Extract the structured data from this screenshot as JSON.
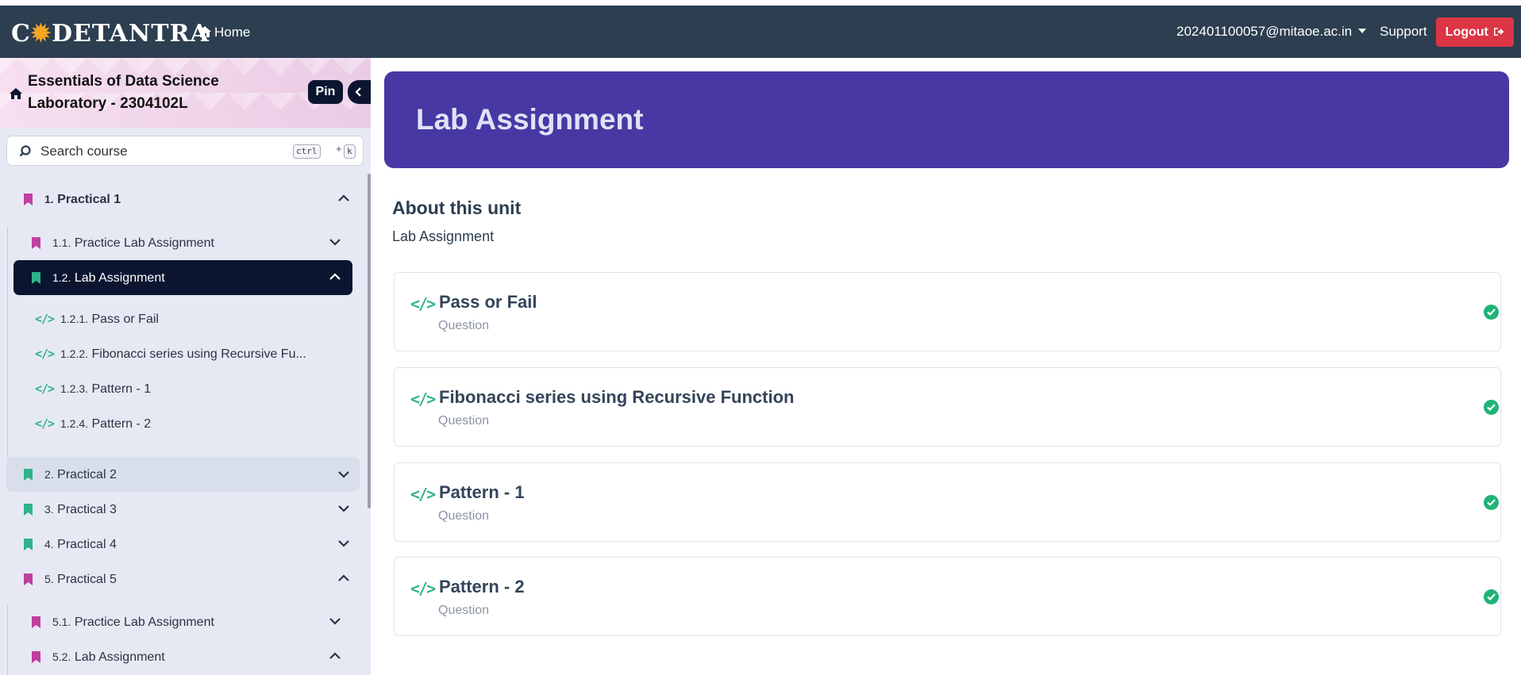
{
  "navbar": {
    "logo": "CODETANTRA",
    "home_label": "Home",
    "user_email": "202401100057@mitaoe.ac.in",
    "support_label": "Support",
    "logout_label": "Logout"
  },
  "sidebar": {
    "course_title": "Essentials of Data Science Laboratory - 2304102L",
    "pin_label": "Pin",
    "search_placeholder": "Search course",
    "shortcut": [
      "ctrl",
      "+",
      "k"
    ],
    "items": [
      {
        "num": "1.",
        "label": "Practical 1",
        "icon": "bookmark-icon",
        "color": "#c03fa0",
        "expanded": true
      },
      {
        "num": "1.1.",
        "label": "Practice Lab Assignment",
        "icon": "bookmark-icon",
        "color": "#c03fa0",
        "expanded": false
      },
      {
        "num": "1.2.",
        "label": "Lab Assignment",
        "icon": "bookmark-icon",
        "color": "#2fb38a",
        "expanded": true,
        "active": true
      },
      {
        "num": "1.2.1.",
        "label": "Pass or Fail",
        "icon": "code-icon"
      },
      {
        "num": "1.2.2.",
        "label": "Fibonacci series using Recursive Fu...",
        "icon": "code-icon"
      },
      {
        "num": "1.2.3.",
        "label": "Pattern - 1",
        "icon": "code-icon"
      },
      {
        "num": "1.2.4.",
        "label": "Pattern - 2",
        "icon": "code-icon"
      },
      {
        "num": "2.",
        "label": "Practical 2",
        "icon": "bookmark-icon",
        "color": "#2fb38a",
        "expanded": false
      },
      {
        "num": "3.",
        "label": "Practical 3",
        "icon": "bookmark-icon",
        "color": "#2fb38a",
        "expanded": false
      },
      {
        "num": "4.",
        "label": "Practical 4",
        "icon": "bookmark-icon",
        "color": "#2fb38a",
        "expanded": false
      },
      {
        "num": "5.",
        "label": "Practical 5",
        "icon": "bookmark-icon",
        "color": "#c03fa0",
        "expanded": true
      },
      {
        "num": "5.1.",
        "label": "Practice Lab Assignment",
        "icon": "bookmark-icon",
        "color": "#c03fa0",
        "expanded": false
      },
      {
        "num": "5.2.",
        "label": "Lab Assignment",
        "icon": "bookmark-icon",
        "color": "#c03fa0",
        "expanded": true
      }
    ]
  },
  "main": {
    "banner_title": "Lab Assignment",
    "about_title": "About this unit",
    "about_subtitle": "Lab Assignment",
    "cards": [
      {
        "title": "Pass or Fail",
        "type": "Question",
        "status": "completed"
      },
      {
        "title": "Fibonacci series using Recursive Function",
        "type": "Question",
        "status": "completed"
      },
      {
        "title": "Pattern - 1",
        "type": "Question",
        "status": "completed"
      },
      {
        "title": "Pattern - 2",
        "type": "Question",
        "status": "completed"
      }
    ]
  },
  "colors": {
    "navbar_bg": "#2c3e50",
    "banner_bg": "#4838a4",
    "logout_bg": "#dc3545",
    "active_item_bg": "#0b1530",
    "success": "#1fb377",
    "pink_bookmark": "#c03fa0",
    "green_bookmark": "#2fb38a"
  }
}
